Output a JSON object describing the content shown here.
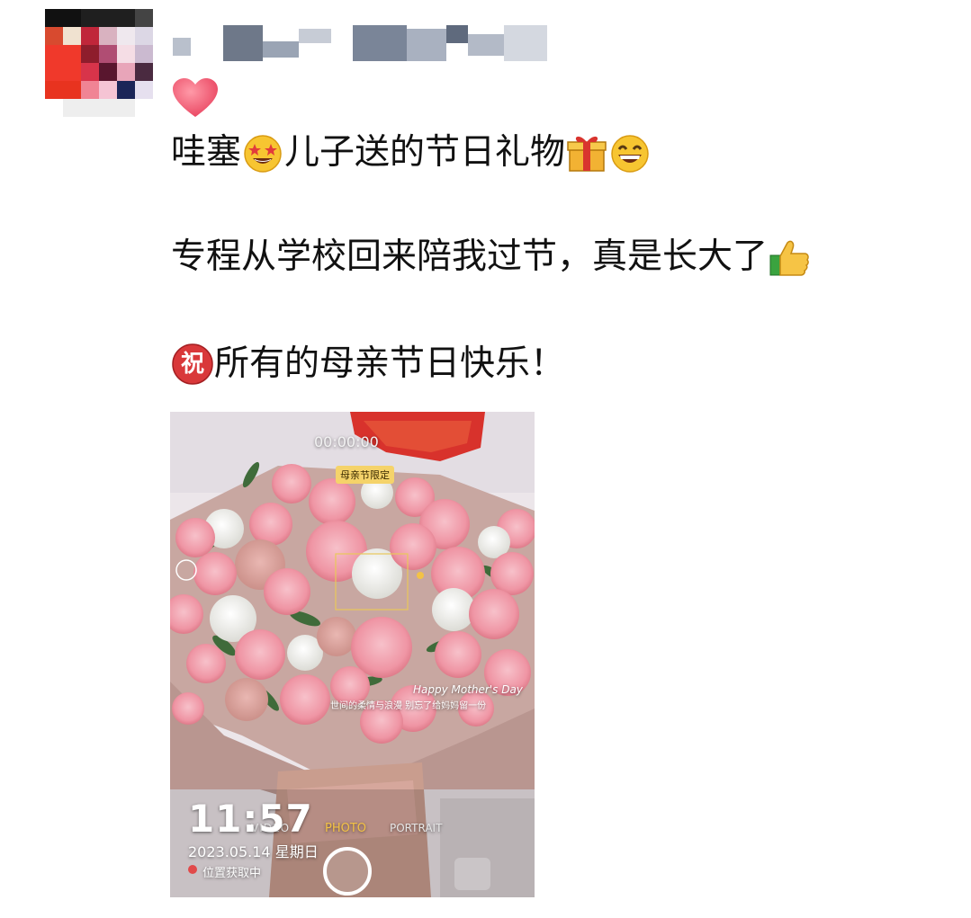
{
  "post": {
    "lines": [
      {
        "before": "哇塞",
        "after": "儿子送的节日礼物",
        "emojis": [
          "star-struck-emoji",
          "gift-emoji",
          "grinning-emoji"
        ]
      },
      {
        "text": "专程从学校回来陪我过节，真是长大了",
        "emoji": "thumbs-up-emoji"
      },
      {
        "badge": "祝",
        "text": "所有的母亲节日快乐！"
      }
    ],
    "reaction_icon": "heart-icon"
  },
  "photo": {
    "timer": "00:00:00",
    "label_limited": "母亲节限定",
    "clock": "11:57",
    "date": "2023.05.14 星期日",
    "location": "位置获取中",
    "mode_video": "VIDEO",
    "mode_photo": "PHOTO",
    "mode_portrait": "PORTRAIT",
    "overlay_title": "Happy Mother's Day",
    "overlay_caption": "世间的柔情与浪漫 别忘了给妈妈留一份"
  },
  "colors": {
    "accent_red": "#d9383a",
    "heart": "#f25b74",
    "carnation": "#f2a0ad",
    "mode_active": "#f3c245"
  }
}
